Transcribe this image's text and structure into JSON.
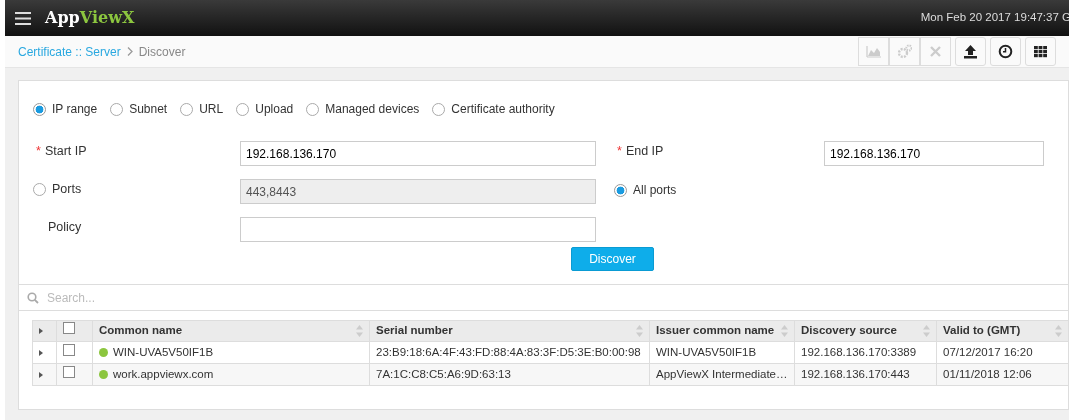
{
  "header": {
    "logo": {
      "first": "App",
      "second": "ViewX"
    },
    "datetime": "Mon Feb 20 2017 19:47:37 G"
  },
  "breadcrumb": {
    "link": "Certificate :: Server",
    "current": "Discover"
  },
  "toolbar": [
    {
      "kind": "chart",
      "disabled": true
    },
    {
      "kind": "gears",
      "disabled": true
    },
    {
      "kind": "close",
      "disabled": true
    },
    {
      "kind": "upload",
      "disabled": false
    },
    {
      "kind": "clock",
      "disabled": false
    },
    {
      "kind": "grid",
      "disabled": false
    }
  ],
  "scan_types": [
    {
      "label": "IP range",
      "selected": true
    },
    {
      "label": "Subnet",
      "selected": false
    },
    {
      "label": "URL",
      "selected": false
    },
    {
      "label": "Upload",
      "selected": false
    },
    {
      "label": "Managed devices",
      "selected": false
    },
    {
      "label": "Certificate authority",
      "selected": false
    }
  ],
  "start_ip": {
    "label": "Start IP",
    "required_mark": "*",
    "value": "192.168.136.170"
  },
  "end_ip": {
    "label": "End IP",
    "required_mark": "*",
    "value": "192.168.136.170"
  },
  "ports": {
    "label": "Ports",
    "selected": false,
    "value": "443,8443",
    "disabled": true
  },
  "all_ports": {
    "label": "All ports",
    "selected": true
  },
  "policy": {
    "label": "Policy"
  },
  "discover_button": "Discover",
  "search": {
    "placeholder": "Search..."
  },
  "table": {
    "header_checked": false,
    "columns": [
      "Common name",
      "Serial number",
      "Issuer common name",
      "Discovery source",
      "Valid to (GMT)"
    ],
    "rows": [
      {
        "expanded": false,
        "checked": false,
        "color": "#8cc63f",
        "cells": [
          "WIN-UVA5V50IF1B",
          "23:B9:18:6A:4F:43:FD:88:4A:83:3F:D5:3E:B0:00:98",
          "WIN-UVA5V50IF1B",
          "192.168.136.170:3389",
          "07/12/2017 16:20"
        ]
      },
      {
        "expanded": false,
        "checked": false,
        "color": "#8cc63f",
        "cells": [
          "work.appviewx.com",
          "7A:1C:C8:C5:A6:9D:63:13",
          "AppViewX Intermediate…",
          "192.168.136.170:443",
          "01/11/2018 12:06"
        ]
      }
    ]
  }
}
